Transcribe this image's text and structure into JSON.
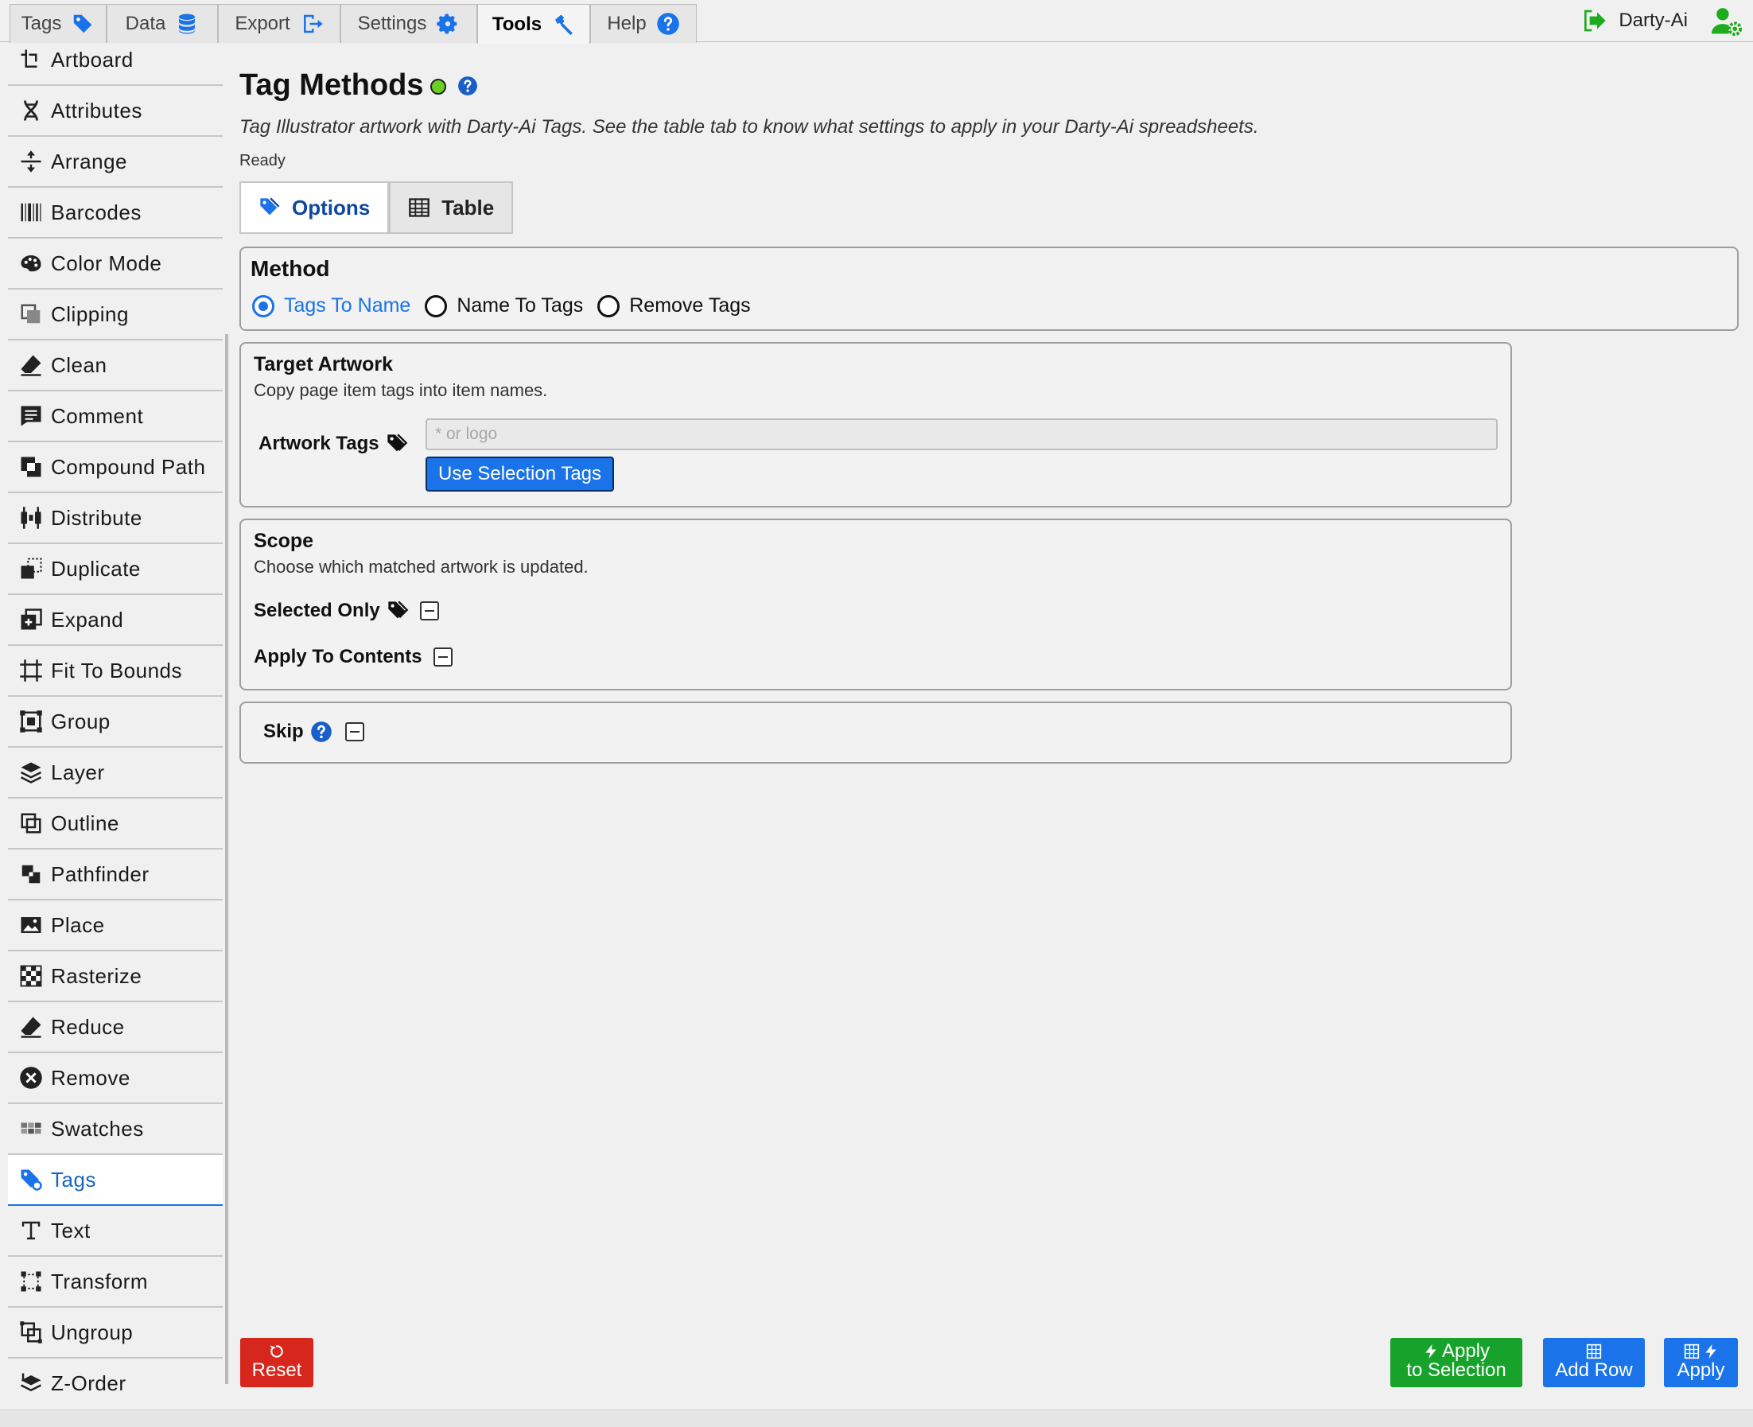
{
  "top_tabs": [
    {
      "label": "Tags",
      "icon": "tag-icon",
      "active": false
    },
    {
      "label": "Data",
      "icon": "database-icon",
      "active": false
    },
    {
      "label": "Export",
      "icon": "export-icon",
      "active": false
    },
    {
      "label": "Settings",
      "icon": "gear-icon",
      "active": false
    },
    {
      "label": "Tools",
      "icon": "hammer-icon",
      "active": true
    },
    {
      "label": "Help",
      "icon": "help-icon",
      "active": false
    }
  ],
  "account": {
    "name": "Darty-Ai"
  },
  "sidebar": {
    "items": [
      {
        "label": "Artboard"
      },
      {
        "label": "Attributes"
      },
      {
        "label": "Arrange"
      },
      {
        "label": "Barcodes"
      },
      {
        "label": "Color Mode"
      },
      {
        "label": "Clipping"
      },
      {
        "label": "Clean"
      },
      {
        "label": "Comment"
      },
      {
        "label": "Compound Path"
      },
      {
        "label": "Distribute"
      },
      {
        "label": "Duplicate"
      },
      {
        "label": "Expand"
      },
      {
        "label": "Fit To Bounds"
      },
      {
        "label": "Group"
      },
      {
        "label": "Layer"
      },
      {
        "label": "Outline"
      },
      {
        "label": "Pathfinder"
      },
      {
        "label": "Place"
      },
      {
        "label": "Rasterize"
      },
      {
        "label": "Reduce"
      },
      {
        "label": "Remove"
      },
      {
        "label": "Swatches"
      },
      {
        "label": "Tags"
      },
      {
        "label": "Text"
      },
      {
        "label": "Transform"
      },
      {
        "label": "Ungroup"
      },
      {
        "label": "Z-Order"
      }
    ],
    "active": "Tags"
  },
  "main": {
    "title": "Tag Methods",
    "description": "Tag Illustrator artwork with Darty-Ai Tags. See the table tab to know what settings to apply in your Darty-Ai spreadsheets.",
    "status": "Ready",
    "tabs": [
      {
        "label": "Options",
        "active": true
      },
      {
        "label": "Table",
        "active": false
      }
    ],
    "method": {
      "title": "Method",
      "options": [
        "Tags To Name",
        "Name To Tags",
        "Remove Tags"
      ],
      "selected": "Tags To Name"
    },
    "target": {
      "title": "Target Artwork",
      "subtitle": "Copy page item tags into item names.",
      "field_label": "Artwork Tags",
      "input_value": "",
      "input_placeholder": "* or logo",
      "button_label": "Use Selection Tags"
    },
    "scope": {
      "title": "Scope",
      "subtitle": "Choose which matched artwork is updated.",
      "selected_only_label": "Selected Only",
      "apply_contents_label": "Apply To Contents"
    },
    "skip": {
      "label": "Skip"
    }
  },
  "footer": {
    "reset_label": "Reset",
    "apply_selection_line1": "Apply",
    "apply_selection_line2": "to Selection",
    "add_row_label": "Add Row",
    "apply_label": "Apply"
  },
  "colors": {
    "accent": "#1a73e8",
    "danger": "#d7261b",
    "success": "#17a32b",
    "status_ok": "#6ad024"
  }
}
